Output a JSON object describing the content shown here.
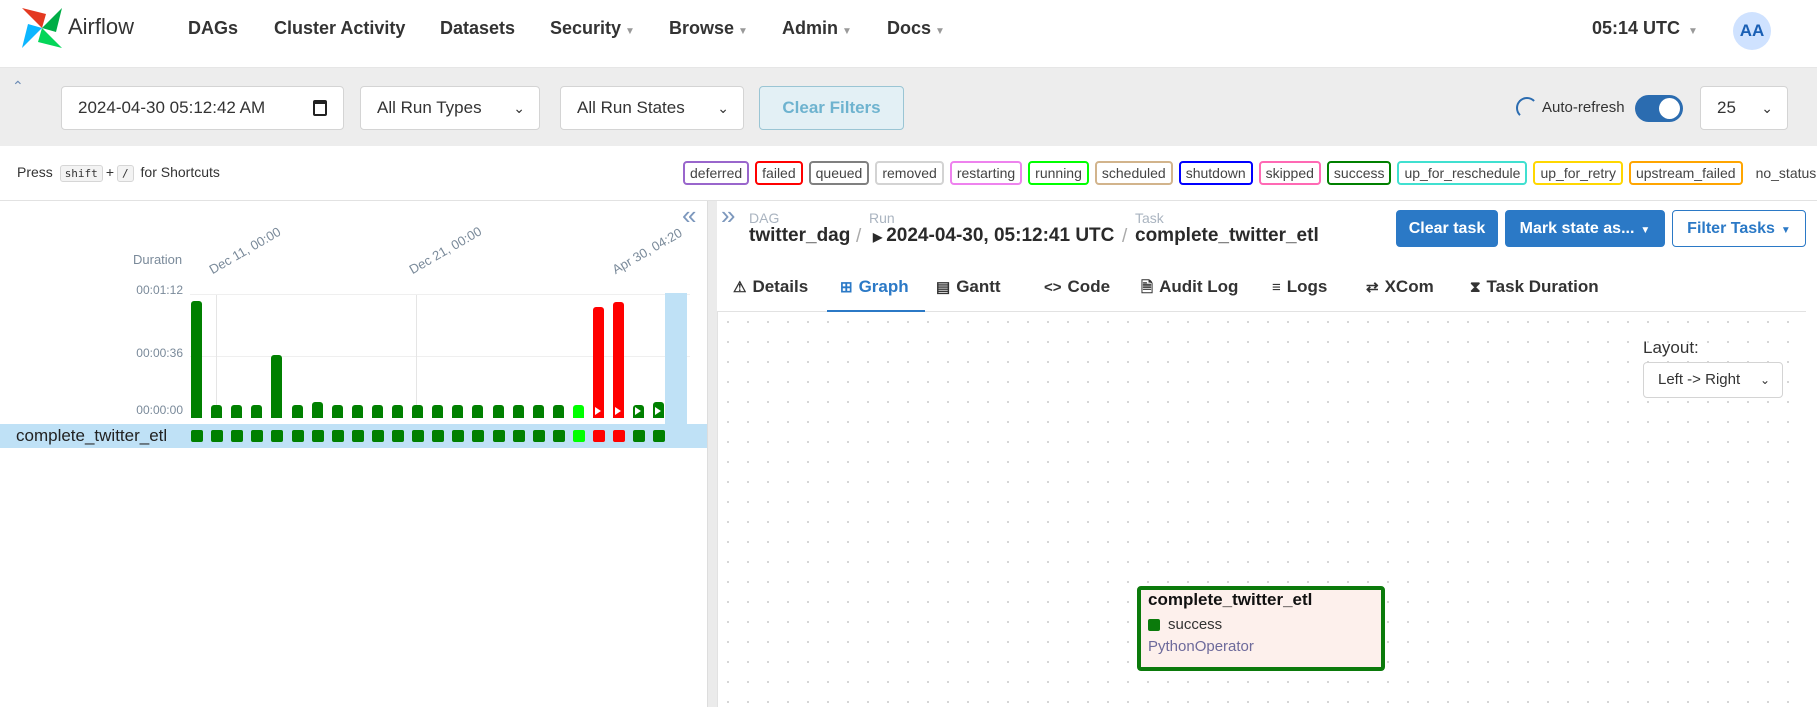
{
  "nav": {
    "brand": "Airflow",
    "items": [
      "DAGs",
      "Cluster Activity",
      "Datasets",
      "Security",
      "Browse",
      "Admin",
      "Docs"
    ],
    "clock": "05:14 UTC",
    "avatar": "AA"
  },
  "filters": {
    "date_value": "2024-04-30  05:12:42  AM",
    "run_types": "All Run Types",
    "run_states": "All Run States",
    "clear_filters": "Clear Filters",
    "auto_refresh": "Auto-refresh",
    "auto_refresh_on": true,
    "page_size": "25"
  },
  "shortcut": {
    "press": "Press",
    "key1": "shift",
    "plus": "+",
    "key2": "/",
    "suffix": "for Shortcuts"
  },
  "legend": [
    {
      "label": "deferred",
      "color": "#9966cc"
    },
    {
      "label": "failed",
      "color": "#ff0000"
    },
    {
      "label": "queued",
      "color": "#808080"
    },
    {
      "label": "removed",
      "color": "#d3d3d3"
    },
    {
      "label": "restarting",
      "color": "#ee82ee"
    },
    {
      "label": "running",
      "color": "#00ff00"
    },
    {
      "label": "scheduled",
      "color": "#d2b48c"
    },
    {
      "label": "shutdown",
      "color": "#0000ff"
    },
    {
      "label": "skipped",
      "color": "#ff69b4"
    },
    {
      "label": "success",
      "color": "#008000"
    },
    {
      "label": "up_for_reschedule",
      "color": "#40e0d0"
    },
    {
      "label": "up_for_retry",
      "color": "#ffd700"
    },
    {
      "label": "upstream_failed",
      "color": "#ffa500"
    },
    {
      "label": "no_status",
      "color": "transparent"
    }
  ],
  "grid": {
    "duration_label": "Duration",
    "y_labels": [
      "00:01:12",
      "00:00:36",
      "00:00:00"
    ],
    "x_dates": [
      "Dec 11, 00:00",
      "Dec 21, 00:00",
      "Apr 30, 04:20"
    ],
    "task_name": "complete_twitter_etl",
    "runs": [
      {
        "state": "success",
        "duration_s": 75
      },
      {
        "state": "success",
        "duration_s": 8
      },
      {
        "state": "success",
        "duration_s": 8
      },
      {
        "state": "success",
        "duration_s": 8
      },
      {
        "state": "success",
        "duration_s": 40
      },
      {
        "state": "success",
        "duration_s": 8
      },
      {
        "state": "success",
        "duration_s": 10
      },
      {
        "state": "success",
        "duration_s": 8
      },
      {
        "state": "success",
        "duration_s": 8
      },
      {
        "state": "success",
        "duration_s": 8
      },
      {
        "state": "success",
        "duration_s": 8
      },
      {
        "state": "success",
        "duration_s": 8
      },
      {
        "state": "success",
        "duration_s": 8
      },
      {
        "state": "success",
        "duration_s": 8
      },
      {
        "state": "success",
        "duration_s": 8
      },
      {
        "state": "success",
        "duration_s": 8
      },
      {
        "state": "success",
        "duration_s": 8
      },
      {
        "state": "success",
        "duration_s": 8
      },
      {
        "state": "success",
        "duration_s": 8
      },
      {
        "state": "running",
        "duration_s": 8
      },
      {
        "state": "failed",
        "duration_s": 71,
        "manual": true
      },
      {
        "state": "failed",
        "duration_s": 74,
        "manual": true
      },
      {
        "state": "success",
        "duration_s": 8,
        "manual": true
      },
      {
        "state": "success",
        "duration_s": 10,
        "manual": true
      }
    ]
  },
  "breadcrumb": {
    "dag_label": "DAG",
    "dag": "twitter_dag",
    "run_label": "Run",
    "run": "2024-04-30, 05:12:41 UTC",
    "task_label": "Task",
    "task": "complete_twitter_etl"
  },
  "actions": {
    "clear_task": "Clear task",
    "mark_state": "Mark state as...",
    "filter_tasks": "Filter Tasks"
  },
  "tabs": [
    {
      "label": "Details",
      "icon": "warning-icon",
      "glyph": "⚠"
    },
    {
      "label": "Graph",
      "icon": "graph-icon",
      "glyph": "⊞",
      "active": true
    },
    {
      "label": "Gantt",
      "icon": "gantt-icon",
      "glyph": "▤"
    },
    {
      "label": "Code",
      "icon": "code-icon",
      "glyph": "<>"
    },
    {
      "label": "Audit Log",
      "icon": "audit-icon",
      "glyph": "🗎"
    },
    {
      "label": "Logs",
      "icon": "logs-icon",
      "glyph": "≡"
    },
    {
      "label": "XCom",
      "icon": "xcom-icon",
      "glyph": "⇄"
    },
    {
      "label": "Task Duration",
      "icon": "hourglass-icon",
      "glyph": "⧗"
    }
  ],
  "graph": {
    "layout_label": "Layout:",
    "layout_value": "Left -> Right",
    "node": {
      "name": "complete_twitter_etl",
      "state": "success",
      "operator": "PythonOperator"
    }
  },
  "colors": {
    "success": "#008000",
    "failed": "#ff0000",
    "running": "#00ff00",
    "accent": "#2b79c6"
  }
}
